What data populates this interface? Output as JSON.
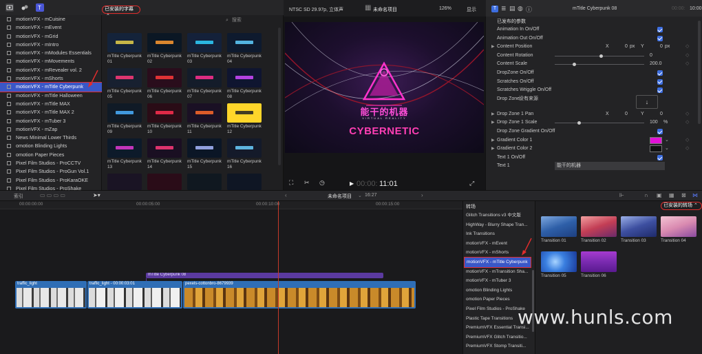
{
  "colors": {
    "accent": "#3a57c7",
    "highlight_red": "#e02d2d",
    "checkbox": "#3d6ee0",
    "title_clip": "#5b3aa0",
    "video_clip": "#2f6eb6",
    "playhead": "#c73a2a"
  },
  "library": {
    "items": [
      "motionVFX - mCuisine",
      "motionVFX - mEvent",
      "motionVFX - mGrid",
      "motionVFX - mIntro",
      "motionVFX - mModules Essentials",
      "motionVFX - mMovements",
      "motionVFX - mRevealer vol. 2",
      "motionVFX - mShorts",
      "motionVFX - mTitle Cyberpunk",
      "motionVFX - mTitle Halloween",
      "motionVFX - mTitle MAX",
      "motionVFX - mTitle MAX 2",
      "motionVFX - mTuber 3",
      "motionVFX - mZap",
      "News Minimal Lower Thirds",
      "omotion Blinding Lights",
      "omotion Paper Pieces",
      "Pixel Film Studios - ProCCTV",
      "Pixel Film Studios - ProGun Vol.1",
      "Pixel Film Studios - ProKaraOKE",
      "Pixel Film Studios - ProShake"
    ],
    "selected_index": 8
  },
  "browser": {
    "filter_label": "已安装的字幕",
    "search_placeholder": "搜索",
    "thumbnails": [
      {
        "label": "mTitle Cyberpunk 01"
      },
      {
        "label": "mTitle Cyberpunk 02"
      },
      {
        "label": "mTitle Cyberpunk 03"
      },
      {
        "label": "mTitle Cyberpunk 04"
      },
      {
        "label": "mTitle Cyberpunk 05"
      },
      {
        "label": "mTitle Cyberpunk 06"
      },
      {
        "label": "mTitle Cyberpunk 07"
      },
      {
        "label": "mTitle Cyberpunk 08"
      },
      {
        "label": "mTitle Cyberpunk 09"
      },
      {
        "label": "mTitle Cyberpunk 10"
      },
      {
        "label": "mTitle Cyberpunk 11"
      },
      {
        "label": "mTitle Cyberpunk 12"
      },
      {
        "label": "mTitle Cyberpunk 13"
      },
      {
        "label": "mTitle Cyberpunk 14"
      },
      {
        "label": "mTitle Cyberpunk 15"
      },
      {
        "label": "mTitle Cyberpunk 16"
      }
    ]
  },
  "viewer": {
    "format": "NTSC SD 29.97p, 立体声",
    "project_name": "未命名项目",
    "zoom": "126%",
    "display_menu": "显示",
    "timecode": "00:00:11:01",
    "timecode_dim": "00:00:",
    "timecode_bright": "11:01",
    "title_cn": "能干的机器",
    "subtitle": "VIRTUAL REALITY",
    "title_en": "CYBERNETIC"
  },
  "inspector": {
    "title_name": "mTitle Cyberpunk 08",
    "duration": "10:00",
    "duration_dim": "00:00:",
    "section": "已发布的参数",
    "params": [
      {
        "label": "Animation In On/Off",
        "type": "check"
      },
      {
        "label": "Animation Out On/Off",
        "type": "check"
      },
      {
        "label": "Content Position",
        "type": "xy",
        "x_label": "X",
        "x": "0",
        "x_unit": "px",
        "y_label": "Y",
        "y": "0",
        "y_unit": "px",
        "disclosure": true
      },
      {
        "label": "Content Rotation",
        "type": "slider",
        "value": "0",
        "level": 0.5
      },
      {
        "label": "Content Scale",
        "type": "slider",
        "value": "200.0",
        "level": 0.2
      },
      {
        "label": "DropZone On/Off",
        "type": "check"
      },
      {
        "label": "Scratches On/Off",
        "type": "check"
      },
      {
        "label": "Scratches Wriggle On/Off",
        "type": "check"
      },
      {
        "label": "Drop Zone:",
        "type": "dropzone",
        "value": "没有来源"
      },
      {
        "label": "Drop Zone 1 Pan",
        "type": "xy",
        "x_label": "X",
        "x": "0",
        "x_unit": "",
        "y_label": "Y",
        "y": "0",
        "y_unit": "",
        "disclosure": true
      },
      {
        "label": "Drop Zone 1 Scale",
        "type": "slider",
        "value": "100",
        "unit": "%",
        "level": 0.25,
        "disclosure": true
      },
      {
        "label": "Drop Zone Gradient On/Off",
        "type": "check"
      },
      {
        "label": "Gradient Color 1",
        "type": "color",
        "color": "#e312d6",
        "disclosure": true
      },
      {
        "label": "Gradient Color 2",
        "type": "color",
        "color": "#111111",
        "disclosure": true
      },
      {
        "label": "Text 1 On/Off",
        "type": "check"
      },
      {
        "label": "Text 1",
        "type": "text",
        "value": "能干的机器"
      }
    ]
  },
  "timeline": {
    "index_label": "索引",
    "project_name": "未命名项目",
    "duration": "16:27",
    "ruler": [
      "00:00:00:00",
      "00:00:05:00",
      "00:00:10:00",
      "00:00:15:00"
    ],
    "title_clip": "mTitle Cyberpunk 08",
    "clips": [
      {
        "name": "traffic_light"
      },
      {
        "name": "traffic_light - 00:00:03:01"
      },
      {
        "name": "pexels-cottonbro-8679939"
      }
    ]
  },
  "transitions": {
    "header": "转场",
    "filter_label": "已安装的转场",
    "items": [
      "Glitch Transitions v3 中文版",
      "HighWay - Blurry Shape Tran...",
      "Ink Transitions",
      "motionVFX - mEvent",
      "motionVFX - mShorts",
      "motionVFX - mTitle Cyberpunk",
      "motionVFX - mTransition Sha...",
      "motionVFX - mTuber 3",
      "omotion Blinding Lights",
      "omotion Paper Pieces",
      "Pixel Film Studios - ProShake",
      "Plastic Tape Transitions",
      "PremiumVFX Essential Transi...",
      "PremiumVFX Glitch Transitio...",
      "PremiumVFX Stomp Transiti..."
    ],
    "selected_index": 5,
    "thumbnails": [
      {
        "label": "Transition 01"
      },
      {
        "label": "Transition 02"
      },
      {
        "label": "Transition 03"
      },
      {
        "label": "Transition 04"
      },
      {
        "label": "Transition 05"
      },
      {
        "label": "Transition 06"
      }
    ]
  },
  "watermark": "www.hunls.com"
}
